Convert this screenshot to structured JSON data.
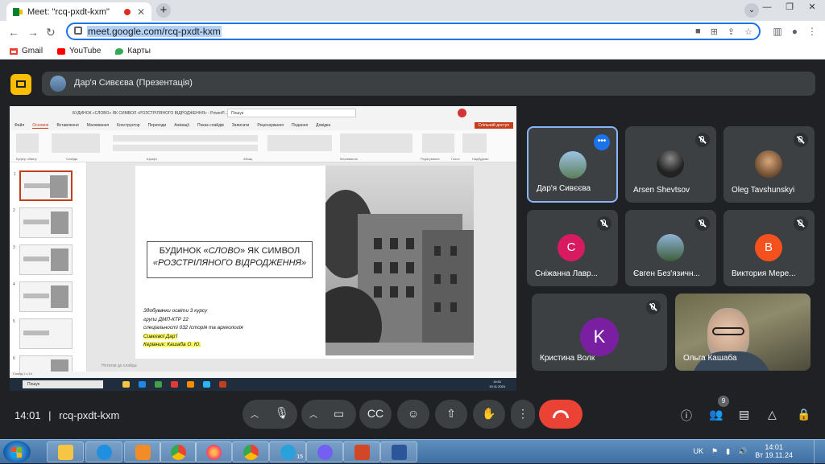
{
  "browser": {
    "tab_title": "Meet: \"rcq-pxdt-kxm\"",
    "url": "meet.google.com/rcq-pxdt-kxm",
    "bookmarks": [
      {
        "label": "Gmail"
      },
      {
        "label": "YouTube"
      },
      {
        "label": "Карты"
      }
    ]
  },
  "meet": {
    "presenter_label": "Дар'я Сивєєва (Презентація)",
    "clock": "14:01",
    "meeting_code": "rcq-pxdt-kxm",
    "participants_badge": "9",
    "participants": [
      {
        "name": "Дар'я Сивєєва",
        "muted": false
      },
      {
        "name": "Arsen Shevtsov",
        "muted": true
      },
      {
        "name": "Oleg Tavshunskyi",
        "muted": true
      },
      {
        "name": "Сніжанна Лавр...",
        "muted": true,
        "initial": "C",
        "color": "#d81b60"
      },
      {
        "name": "Євген Без'язичн...",
        "muted": true
      },
      {
        "name": "Виктория Мере...",
        "muted": true,
        "initial": "В",
        "color": "#f4511e"
      },
      {
        "name": "Кристина Волк",
        "muted": true,
        "initial": "K",
        "color": "#7b1fa2"
      },
      {
        "name": "Ольга Кашаба",
        "muted": false
      }
    ]
  },
  "share": {
    "window_title": "БУДИНОК «СЛОВО» ЯК СИМВОЛ «РОЗСТРІЛЯНОГО ВІДРОДЖЕННЯ» - PowerP...",
    "search_placeholder": "Пошук",
    "menu": [
      "Файл",
      "Основне",
      "Вставлення",
      "Малювання",
      "Конструктор",
      "Переходи",
      "Анімації",
      "Показ слайдів",
      "Записати",
      "Рецензування",
      "Подання",
      "Довідка"
    ],
    "share_button": "Спільний доступ",
    "ribbon_groups": [
      "Буфер обміну",
      "Слайди",
      "Шрифт",
      "Абзац",
      "Малювання",
      "Редагування",
      "Голос",
      "Надбудови"
    ],
    "slide_title_line1_pre": "БУДИНОК «",
    "slide_title_line1_em": "СЛОВО",
    "slide_title_line1_post": "» ЯК СИМВОЛ",
    "slide_title_line2": "«РОЗСТРІЛЯНОГО ВІДРОДЖЕННЯ»",
    "info": [
      "Здобувачки освіти 3 курсу",
      "групи ДМП-КТР 22",
      "спеціальності 032 Історія та археологія",
      "Сивєєвої Дар'ї",
      "Керівник: Кашаба О. Ю."
    ],
    "notes_placeholder": "Нотатки до слайда",
    "status": "Слайд 1 з 14",
    "taskbar_search": "Пошук",
    "taskbar_time": "14:01",
    "taskbar_date": "19.11.2024"
  },
  "windows": {
    "lang": "UK",
    "time": "14:01",
    "date": "Вт 19.11.24",
    "telegram_badge": "15"
  }
}
